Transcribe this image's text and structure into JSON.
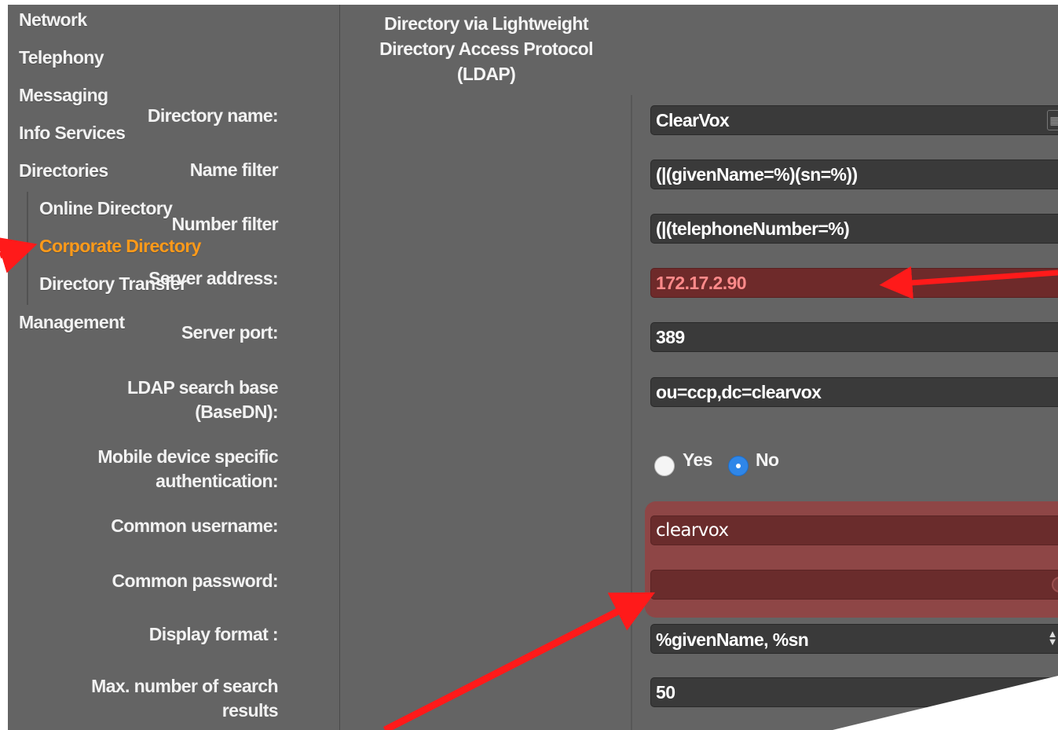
{
  "sidebar": {
    "items": [
      {
        "label": "Network"
      },
      {
        "label": "Telephony"
      },
      {
        "label": "Messaging"
      },
      {
        "label": "Info Services"
      },
      {
        "label": "Directories"
      },
      {
        "label": "Management"
      }
    ],
    "sub_items": [
      {
        "label": "Online Directory"
      },
      {
        "label": "Corporate Directory",
        "active": true
      },
      {
        "label": "Directory Transfer"
      }
    ]
  },
  "form": {
    "section_title": "Directory via Lightweight Directory Access Protocol (LDAP)",
    "directory_name": {
      "label": "Directory name:",
      "value": "ClearVox"
    },
    "name_filter": {
      "label": "Name filter",
      "value": "(|(givenName=%)(sn=%))"
    },
    "number_filter": {
      "label": "Number filter",
      "value": "(|(telephoneNumber=%)"
    },
    "server_address": {
      "label": "Server address:",
      "value": "172.17.2.90"
    },
    "server_port": {
      "label": "Server port:",
      "value": "389"
    },
    "search_base": {
      "label": "LDAP search base (BaseDN):",
      "value": "ou=ccp,dc=clearvox"
    },
    "mobile_auth": {
      "label": "Mobile device specific authentication:",
      "yes_label": "Yes",
      "no_label": "No",
      "selected": "No"
    },
    "common_username": {
      "label": "Common username:",
      "value": "clearvox"
    },
    "common_password": {
      "label": "Common password:",
      "value": ""
    },
    "display_format": {
      "label": "Display format :",
      "value": "%givenName, %sn"
    },
    "max_results": {
      "label": "Max. number of search results",
      "value": "50"
    }
  },
  "colors": {
    "active_nav": "#ff9a1a",
    "panel_bg": "#646464",
    "highlight_red": "#8e4646",
    "arrow_red": "#ff1a1a"
  },
  "icons": [
    "contact-card-icon",
    "key-icon",
    "select-arrows-icon",
    "arrow-annotation"
  ]
}
